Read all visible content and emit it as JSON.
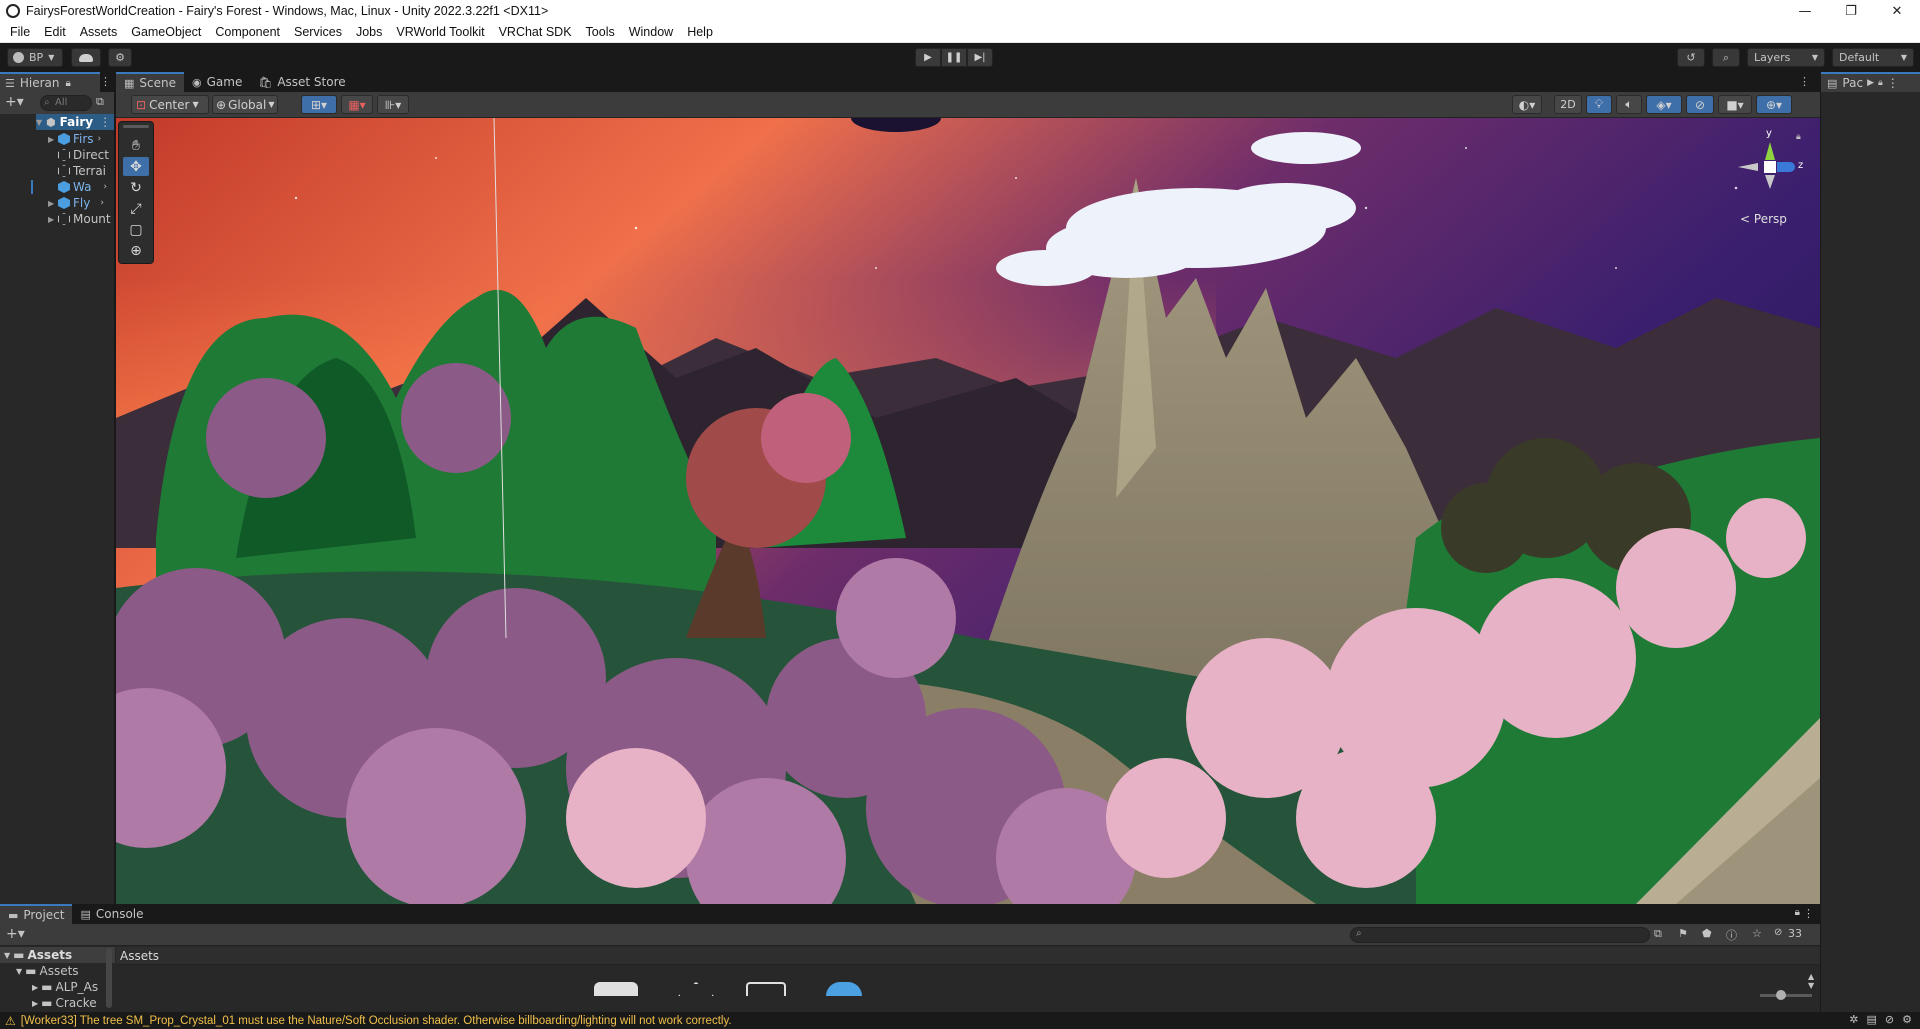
{
  "window": {
    "title": "FairysForestWorldCreation - Fairy's Forest - Windows, Mac, Linux - Unity 2022.3.22f1 <DX11>",
    "controls": {
      "minimize": "—",
      "maximize": "❐",
      "close": "✕"
    }
  },
  "menu": [
    "File",
    "Edit",
    "Assets",
    "GameObject",
    "Component",
    "Services",
    "Jobs",
    "VRWorld Toolkit",
    "VRChat SDK",
    "Tools",
    "Window",
    "Help"
  ],
  "toolbar": {
    "account": "BP",
    "layers": "Layers",
    "layout": "Default"
  },
  "hierarchy": {
    "tab": "Hieran",
    "search_placeholder": "All",
    "scene_name": "Fairy",
    "items": [
      {
        "label": "Firs",
        "type": "prefab"
      },
      {
        "label": "Direct",
        "type": "object"
      },
      {
        "label": "Terrai",
        "type": "object"
      },
      {
        "label": "Wa",
        "type": "prefab"
      },
      {
        "label": "Fly",
        "type": "prefab"
      },
      {
        "label": "Mount",
        "type": "object"
      }
    ]
  },
  "scene_tabs": [
    {
      "label": "Scene",
      "icon": "scene-icon",
      "active": true
    },
    {
      "label": "Game",
      "icon": "game-icon",
      "active": false
    },
    {
      "label": "Asset Store",
      "icon": "store-icon",
      "active": false
    }
  ],
  "scene_toolbar": {
    "pivot": "Center",
    "space": "Global",
    "mode_2d": "2D"
  },
  "gizmo": {
    "y": "y",
    "z": "z",
    "projection": "Persp"
  },
  "inspector_tab": "Pac",
  "project": {
    "tabs": [
      "Project",
      "Console"
    ],
    "tree": [
      "Assets",
      "Assets",
      "ALP_As",
      "Cracke"
    ],
    "breadcrumb": "Assets",
    "hidden_count": "33"
  },
  "status": {
    "message": "[Worker33] The tree SM_Prop_Crystal_01 must use the Nature/Soft Occlusion shader. Otherwise billboarding/lighting will not work correctly."
  },
  "colors": {
    "accent": "#3a79bb",
    "prefab": "#7bb3ea",
    "warning": "#f0c04a"
  }
}
